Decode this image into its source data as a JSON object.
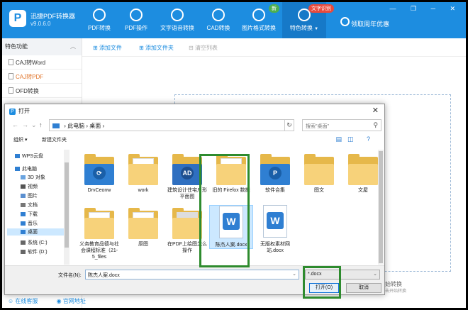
{
  "app": {
    "name": "迅捷PDF转换器",
    "version": "v9.0.6.0",
    "nav": [
      {
        "label": "PDF转换",
        "icon": "pdf-convert-icon"
      },
      {
        "label": "PDF操作",
        "icon": "pdf-operate-icon"
      },
      {
        "label": "文字语音转换",
        "icon": "text-to-speech-icon"
      },
      {
        "label": "CAD转换",
        "icon": "cad-convert-icon"
      },
      {
        "label": "图片格式转换",
        "icon": "image-format-icon"
      },
      {
        "label": "特色转换",
        "icon": "special-convert-icon"
      }
    ],
    "badge_new": "新",
    "badge_ocr": "文字识别",
    "active_caret": "▼",
    "promo": "领取周年优惠",
    "win_controls": "— ❐ ─ ✕"
  },
  "sidebar": {
    "title": "特色功能",
    "chevron": "︿",
    "items": [
      "CAJ转Word",
      "CAJ转PDF",
      "OFD转换"
    ]
  },
  "toolbar": {
    "add_file": "添加文件",
    "add_folder": "添加文件夹",
    "clear_list": "清空列表"
  },
  "start_hint": {
    "main": "始转换",
    "sub": "击开始转换"
  },
  "bottom_links": {
    "service": "在线客服",
    "website": "官网地址"
  },
  "dialog": {
    "title": "打开",
    "close": "✕",
    "path": [
      "此电脑",
      "桌面"
    ],
    "search_placeholder": "搜索\"桌面\"",
    "organize": "组织 ▾",
    "new_folder": "新建文件夹",
    "nav_items": [
      {
        "label": "WPS云盘",
        "color": "#2f7fd2"
      },
      {
        "label": "此电脑",
        "color": "#2f7fd2"
      },
      {
        "label": "3D 对象",
        "color": "#6aa4e0"
      },
      {
        "label": "视频",
        "color": "#555555"
      },
      {
        "label": "图片",
        "color": "#5a8fd0"
      },
      {
        "label": "文档",
        "color": "#777777"
      },
      {
        "label": "下载",
        "color": "#2f7fd2"
      },
      {
        "label": "音乐",
        "color": "#2f7fd2"
      },
      {
        "label": "桌面",
        "color": "#2f7fd2"
      },
      {
        "label": "系统 (C:)",
        "color": "#666666"
      },
      {
        "label": "软件 (D:)",
        "color": "#666666"
      }
    ],
    "files": [
      {
        "label": "DrvCeonw",
        "type": "folder-app"
      },
      {
        "label": "work",
        "type": "folder"
      },
      {
        "label": "建筑设计住宅户形平面图",
        "type": "folder-cad"
      },
      {
        "label": "旧的 Firefox 数据",
        "type": "folder"
      },
      {
        "label": "软件合集",
        "type": "folder-app"
      },
      {
        "label": "图文",
        "type": "folder"
      },
      {
        "label": "文屋",
        "type": "folder"
      },
      {
        "label": "义务教育品德与社会课程标准（21-5_files",
        "type": "folder"
      },
      {
        "label": "原图",
        "type": "folder"
      },
      {
        "label": "在PDF上绘图怎么操作",
        "type": "folder"
      },
      {
        "label": "陈杰人案.docx",
        "type": "docx"
      },
      {
        "label": "无版权素材网站.docx",
        "type": "docx"
      }
    ],
    "filename_label": "文件名(N):",
    "filename_value": "陈杰人案.docx",
    "filetype_value": "*.docx",
    "open_label": "打开(O)",
    "cancel_label": "取消"
  },
  "colors": {
    "brand": "#1d8de0",
    "highlight": "#2e8b2e",
    "folder": "#e6b84a",
    "word": "#2f7fd2"
  }
}
